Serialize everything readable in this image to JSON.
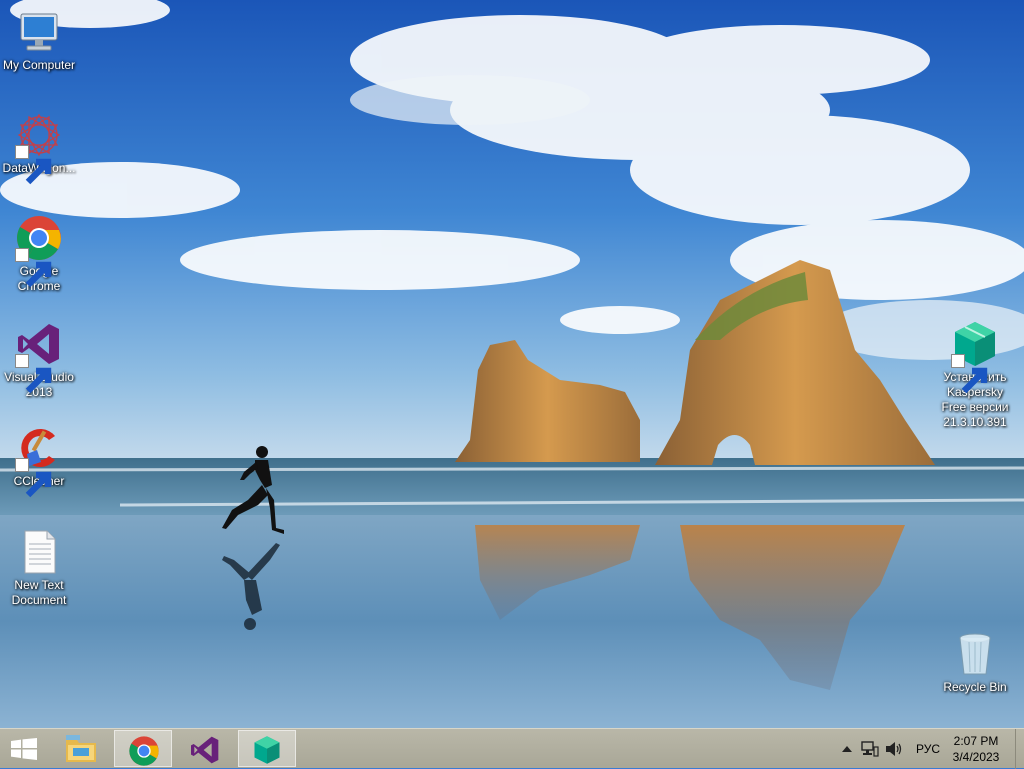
{
  "desktop": {
    "icons": [
      {
        "id": "my-computer",
        "label": "My Computer",
        "icon": "computer-icon"
      },
      {
        "id": "datawagon",
        "label": "DataWagon...",
        "icon": "datawagon-icon",
        "shortcut": true
      },
      {
        "id": "google-chrome",
        "label": "Google Chrome",
        "icon": "chrome-icon",
        "shortcut": true
      },
      {
        "id": "visual-studio",
        "label": "Visual Studio 2013",
        "icon": "visual-studio-icon",
        "shortcut": true
      },
      {
        "id": "ccleaner",
        "label": "CCleaner",
        "icon": "ccleaner-icon",
        "shortcut": true
      },
      {
        "id": "new-text-document",
        "label": "New Text Document",
        "icon": "text-document-icon"
      },
      {
        "id": "kaspersky",
        "label": "Установить Kaspersky Free версии 21.3.10.391",
        "icon": "kaspersky-icon",
        "shortcut": true
      },
      {
        "id": "recycle-bin",
        "label": "Recycle Bin",
        "icon": "recycle-bin-icon"
      }
    ]
  },
  "taskbar": {
    "start": {
      "icon": "windows-logo-icon"
    },
    "pinned": [
      {
        "name": "File Explorer",
        "icon": "file-explorer-icon",
        "active": false
      },
      {
        "name": "Google Chrome",
        "icon": "chrome-icon",
        "active": true
      },
      {
        "name": "Visual Studio",
        "icon": "visual-studio-icon",
        "active": false
      },
      {
        "name": "Kaspersky",
        "icon": "kaspersky-icon",
        "active": true
      }
    ],
    "tray": {
      "overflow_icon": "chevron-up-icon",
      "network_icon": "network-icon",
      "volume_icon": "speaker-icon",
      "language": "РУС",
      "time": "2:07 PM",
      "date": "3/4/2023"
    }
  },
  "colors": {
    "taskbar": "#b1af9f",
    "sky_top": "#1f5fbf",
    "sky_horizon": "#a9cbe6",
    "sea": "#5f8fae",
    "rock": "#c8904a"
  }
}
